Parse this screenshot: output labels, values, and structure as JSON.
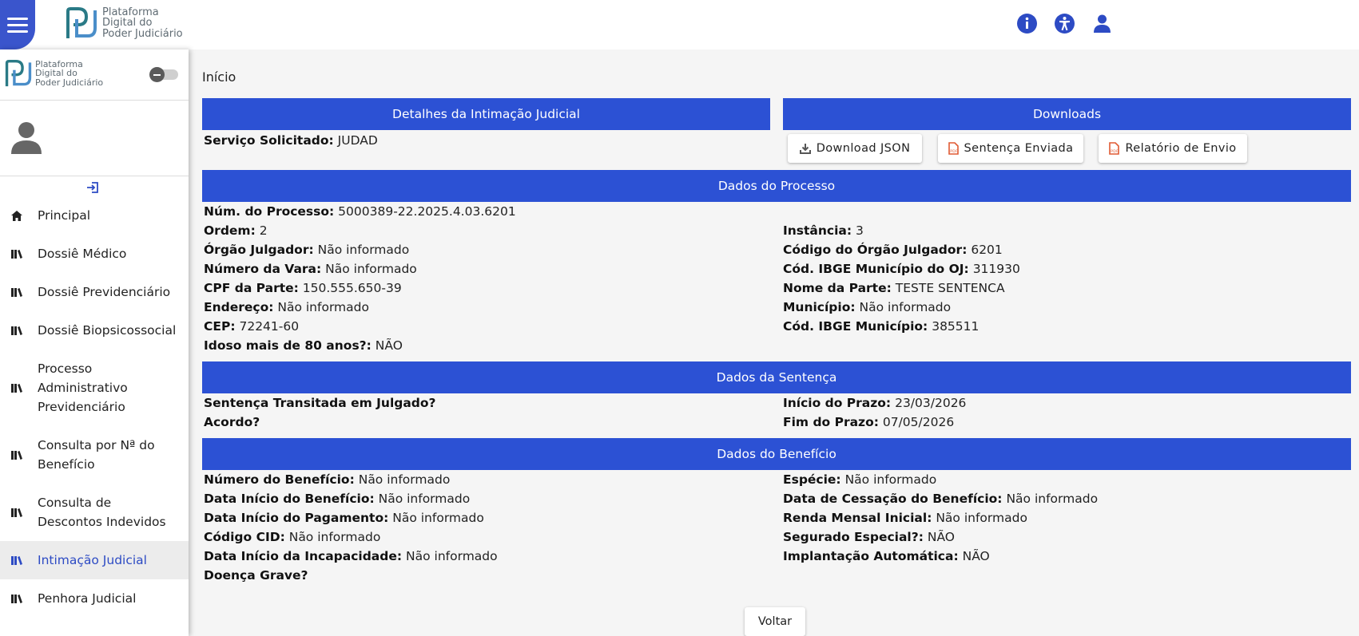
{
  "app": {
    "logo_line1": "Plataforma",
    "logo_line2": "Digital do",
    "logo_line3": "Poder Judiciário"
  },
  "sidebar": {
    "items": [
      {
        "label": "Principal",
        "icon": "home-icon"
      },
      {
        "label": "Dossiê Médico",
        "icon": "library-icon"
      },
      {
        "label": "Dossiê Previdenciário",
        "icon": "library-icon"
      },
      {
        "label": "Dossiê Biopsicossocial",
        "icon": "library-icon"
      },
      {
        "label": "Processo Administrativo Previdenciário",
        "icon": "library-icon"
      },
      {
        "label": "Consulta por Nª do Benefício",
        "icon": "library-icon"
      },
      {
        "label": "Consulta de Descontos Indevidos",
        "icon": "library-icon"
      },
      {
        "label": "Intimação Judicial",
        "icon": "library-icon",
        "active": true
      },
      {
        "label": "Penhora Judicial",
        "icon": "library-icon"
      }
    ]
  },
  "breadcrumb": "Início",
  "detalhes": {
    "title": "Detalhes da Intimação Judicial",
    "servico_label": "Serviço Solicitado:",
    "servico_value": "JUDAD"
  },
  "downloads": {
    "title": "Downloads",
    "json_label": "Download JSON",
    "sentenca_label": "Sentença Enviada",
    "relatorio_label": "Relatório de Envio"
  },
  "processo": {
    "title": "Dados do Processo",
    "num_label": "Núm. do Processo:",
    "num_value": "5000389-22.2025.4.03.6201",
    "left": [
      {
        "label": "Ordem:",
        "value": "2"
      },
      {
        "label": "Órgão Julgador:",
        "value": "Não informado"
      },
      {
        "label": "Número da Vara:",
        "value": "Não informado"
      },
      {
        "label": "CPF da Parte:",
        "value": "150.555.650-39"
      },
      {
        "label": "Endereço:",
        "value": "Não informado"
      },
      {
        "label": "CEP:",
        "value": "72241-60"
      },
      {
        "label": "Idoso mais de 80 anos?:",
        "value": "NÃO"
      }
    ],
    "right": [
      {
        "label": "Instância:",
        "value": "3"
      },
      {
        "label": "Código do Órgão Julgador:",
        "value": "6201"
      },
      {
        "label": "Cód. IBGE Município do OJ:",
        "value": "311930"
      },
      {
        "label": "Nome da Parte:",
        "value": "TESTE SENTENCA"
      },
      {
        "label": "Município:",
        "value": "Não informado"
      },
      {
        "label": "Cód. IBGE Município:",
        "value": "385511"
      }
    ]
  },
  "sentenca": {
    "title": "Dados da Sentença",
    "left": [
      {
        "label": "Sentença Transitada em Julgado?",
        "value": ""
      },
      {
        "label": "Acordo?",
        "value": ""
      }
    ],
    "right": [
      {
        "label": "Início do Prazo:",
        "value": "23/03/2026"
      },
      {
        "label": "Fim do Prazo:",
        "value": "07/05/2026"
      }
    ]
  },
  "beneficio": {
    "title": "Dados do Benefício",
    "left": [
      {
        "label": "Número do Benefício:",
        "value": "Não informado"
      },
      {
        "label": "Data Início do Benefício:",
        "value": "Não informado"
      },
      {
        "label": "Data Início do Pagamento:",
        "value": "Não informado"
      },
      {
        "label": "Código CID:",
        "value": "Não informado"
      },
      {
        "label": "Data Início da Incapacidade:",
        "value": "Não informado"
      },
      {
        "label": "Doença Grave?",
        "value": ""
      }
    ],
    "right": [
      {
        "label": "Espécie:",
        "value": "Não informado"
      },
      {
        "label": "Data de Cessação do Benefício:",
        "value": "Não informado"
      },
      {
        "label": "Renda Mensal Inicial:",
        "value": "Não informado"
      },
      {
        "label": "Segurado Especial?:",
        "value": "NÃO"
      },
      {
        "label": "Implantação Automática:",
        "value": "NÃO"
      }
    ]
  },
  "actions": {
    "voltar_label": "Voltar"
  },
  "colors": {
    "primary": "#2c51d4",
    "menu_button": "#3a55cc",
    "pdf_icon": "#e05a33"
  }
}
